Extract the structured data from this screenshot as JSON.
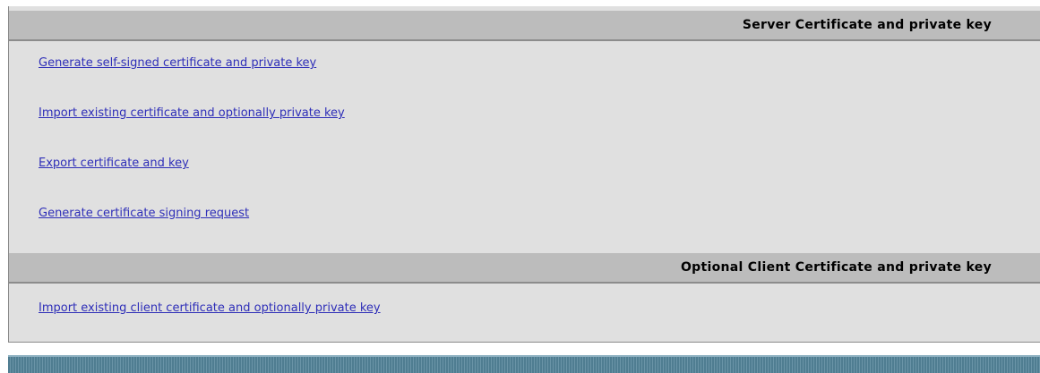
{
  "sections": [
    {
      "title": "Server Certificate and private key",
      "links": [
        "Generate self-signed certificate and private key ",
        "Import existing certificate and optionally private key",
        "Export certificate and key",
        "Generate certificate signing request"
      ]
    },
    {
      "title": "Optional Client Certificate and private key",
      "links": [
        "Import existing client certificate and optionally private key"
      ]
    }
  ],
  "colors": {
    "link": "#2e2eb8",
    "panel_background": "#e0e0e0",
    "header_background": "#bcbcbc",
    "footer_bar": "#4f7d91"
  }
}
